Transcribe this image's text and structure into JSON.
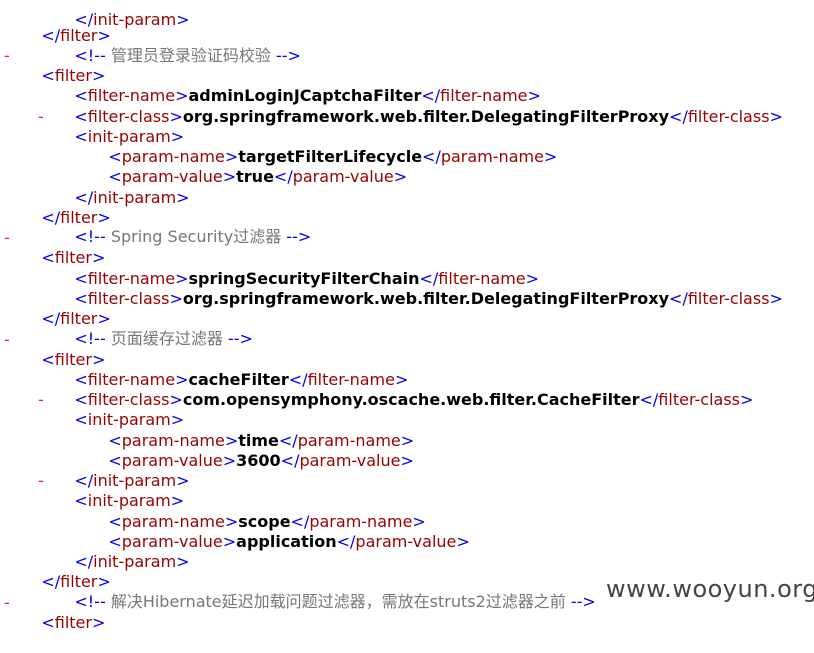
{
  "lines": [
    {
      "id": "l0",
      "kind": "tag",
      "close": true,
      "name": "init-param"
    },
    {
      "id": "l1",
      "kind": "tag",
      "close": true,
      "name": "filter"
    },
    {
      "id": "l2",
      "kind": "comment",
      "text": "管理员登录验证码校验"
    },
    {
      "id": "l3",
      "kind": "tag",
      "name": "filter",
      "collapsible": true
    },
    {
      "id": "l4",
      "kind": "elem",
      "name": "filter-name",
      "value": "adminLoginJCaptchaFilter"
    },
    {
      "id": "l5",
      "kind": "elem",
      "name": "filter-class",
      "value": "org.springframework.web.filter.DelegatingFilterProxy"
    },
    {
      "id": "l6",
      "kind": "tag",
      "name": "init-param",
      "collapsible": true
    },
    {
      "id": "l7",
      "kind": "elem",
      "name": "param-name",
      "value": "targetFilterLifecycle"
    },
    {
      "id": "l8",
      "kind": "elem",
      "name": "param-value",
      "value": "true"
    },
    {
      "id": "l9",
      "kind": "tag",
      "close": true,
      "name": "init-param"
    },
    {
      "id": "l10",
      "kind": "tag",
      "close": true,
      "name": "filter"
    },
    {
      "id": "l11",
      "kind": "comment",
      "text": "Spring Security过滤器"
    },
    {
      "id": "l12",
      "kind": "tag",
      "name": "filter",
      "collapsible": true
    },
    {
      "id": "l13",
      "kind": "elem",
      "name": "filter-name",
      "value": "springSecurityFilterChain"
    },
    {
      "id": "l14",
      "kind": "elem",
      "name": "filter-class",
      "value": "org.springframework.web.filter.DelegatingFilterProxy"
    },
    {
      "id": "l15",
      "kind": "tag",
      "close": true,
      "name": "filter"
    },
    {
      "id": "l16",
      "kind": "comment",
      "text": "页面缓存过滤器"
    },
    {
      "id": "l17",
      "kind": "tag",
      "name": "filter",
      "collapsible": true
    },
    {
      "id": "l18",
      "kind": "elem",
      "name": "filter-name",
      "value": "cacheFilter"
    },
    {
      "id": "l19",
      "kind": "elem",
      "name": "filter-class",
      "value": "com.opensymphony.oscache.web.filter.CacheFilter"
    },
    {
      "id": "l20",
      "kind": "tag",
      "name": "init-param",
      "collapsible": true
    },
    {
      "id": "l21",
      "kind": "elem",
      "name": "param-name",
      "value": "time"
    },
    {
      "id": "l22",
      "kind": "elem",
      "name": "param-value",
      "value": "3600"
    },
    {
      "id": "l23",
      "kind": "tag",
      "close": true,
      "name": "init-param"
    },
    {
      "id": "l24",
      "kind": "tag",
      "name": "init-param",
      "collapsible": true
    },
    {
      "id": "l25",
      "kind": "elem",
      "name": "param-name",
      "value": "scope"
    },
    {
      "id": "l26",
      "kind": "elem",
      "name": "param-value",
      "value": "application"
    },
    {
      "id": "l27",
      "kind": "tag",
      "close": true,
      "name": "init-param"
    },
    {
      "id": "l28",
      "kind": "tag",
      "close": true,
      "name": "filter"
    },
    {
      "id": "l29",
      "kind": "comment",
      "text": "解决Hibernate延迟加载问题过滤器，需放在struts2过滤器之前"
    },
    {
      "id": "l30",
      "kind": "tag",
      "name": "filter",
      "collapsible": true
    }
  ],
  "collapse_symbol": "-",
  "watermark": "www.wooyun.org"
}
